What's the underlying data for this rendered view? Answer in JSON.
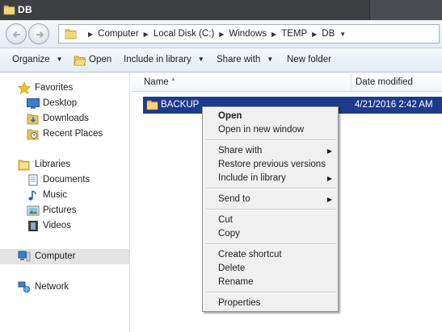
{
  "window": {
    "title": "DB",
    "icon": "folder-icon"
  },
  "navigation": {
    "back_icon": "back-arrow-icon",
    "forward_icon": "forward-arrow-icon",
    "breadcrumbs": [
      "Computer",
      "Local Disk (C:)",
      "Windows",
      "TEMP",
      "DB"
    ]
  },
  "toolbar": {
    "organize": "Organize",
    "open": "Open",
    "include_in_library": "Include in library",
    "share_with": "Share with",
    "new_folder": "New folder"
  },
  "nav_pane": {
    "favorites": "Favorites",
    "desktop": "Desktop",
    "downloads": "Downloads",
    "recent_places": "Recent Places",
    "libraries": "Libraries",
    "documents": "Documents",
    "music": "Music",
    "pictures": "Pictures",
    "videos": "Videos",
    "computer": "Computer",
    "network": "Network"
  },
  "columns": {
    "name": "Name",
    "date_modified": "Date modified"
  },
  "files": [
    {
      "name": "BACKUP",
      "date": "4/21/2016 2:42 AM",
      "type": "folder"
    }
  ],
  "context_menu": {
    "open": "Open",
    "open_new_window": "Open in new window",
    "share_with": "Share with",
    "restore_previous": "Restore previous versions",
    "include_in_library": "Include in library",
    "send_to": "Send to",
    "cut": "Cut",
    "copy": "Copy",
    "create_shortcut": "Create shortcut",
    "delete": "Delete",
    "rename": "Rename",
    "properties": "Properties"
  },
  "colors": {
    "title_bar": "#3d3f43",
    "selection": "#1e3a8a",
    "folder": "#e8c45a"
  }
}
